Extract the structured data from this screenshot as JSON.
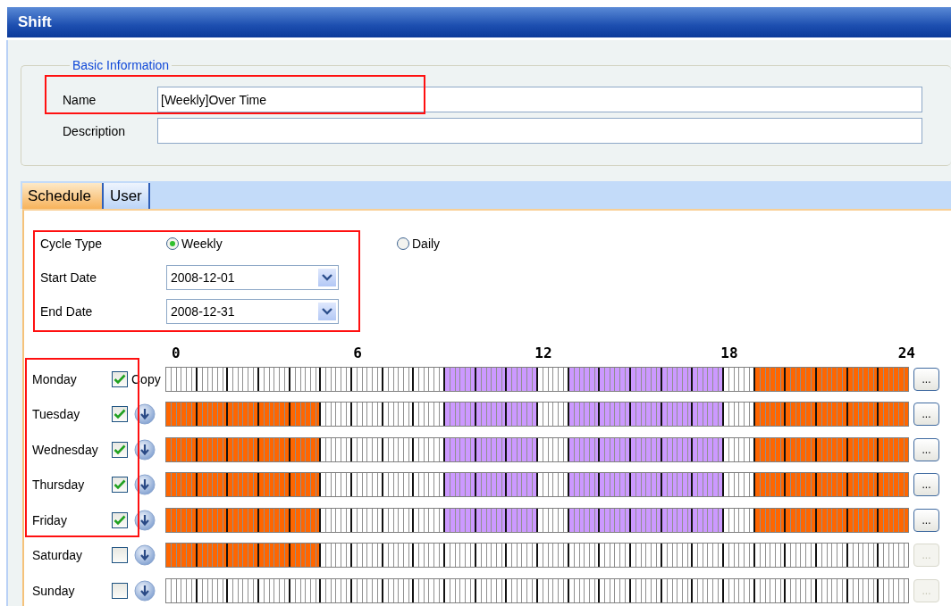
{
  "window": {
    "title": "Shift"
  },
  "basic_information": {
    "legend": "Basic Information",
    "name": {
      "label": "Name",
      "value": "[Weekly]Over Time"
    },
    "description": {
      "label": "Description"
    }
  },
  "tabs": [
    {
      "label": "Schedule",
      "selected": true
    },
    {
      "label": "User",
      "selected": false
    }
  ],
  "cycle_type": {
    "label": "Cycle Type",
    "options": [
      {
        "label": "Weekly",
        "selected": true
      },
      {
        "label": "Daily",
        "selected": false
      }
    ]
  },
  "start_date": {
    "label": "Start Date",
    "value": "2008-12-01"
  },
  "end_date": {
    "label": "End Date",
    "value": "2008-12-31"
  },
  "hour_labels": [
    "0",
    "6",
    "12",
    "18",
    "24"
  ],
  "days": [
    {
      "name": "Monday",
      "checked": true,
      "action": {
        "kind": "copy",
        "label": "Copy"
      },
      "button": "...",
      "button_disabled": false,
      "hours": [
        {
          "color": "#ffffff"
        },
        {
          "color": "#ffffff"
        },
        {
          "color": "#ffffff"
        },
        {
          "color": "#ffffff"
        },
        {
          "color": "#ffffff"
        },
        {
          "color": "#ffffff"
        },
        {
          "color": "#ffffff"
        },
        {
          "color": "#ffffff"
        },
        {
          "color": "#ffffff"
        },
        {
          "color": "#cc99ff"
        },
        {
          "color": "#cc99ff"
        },
        {
          "color": "#cc99ff"
        },
        {
          "color": "#ffffff"
        },
        {
          "color": "#cc99ff"
        },
        {
          "color": "#cc99ff"
        },
        {
          "color": "#cc99ff"
        },
        {
          "color": "#cc99ff"
        },
        {
          "color": "#cc99ff"
        },
        {
          "color": "#ffffff"
        },
        {
          "color": "#ff6600"
        },
        {
          "color": "#ff6600"
        },
        {
          "color": "#ff6600"
        },
        {
          "color": "#ff6600"
        },
        {
          "color": "#ff6600"
        }
      ]
    },
    {
      "name": "Tuesday",
      "checked": true,
      "action": {
        "kind": "arrow"
      },
      "button": "...",
      "button_disabled": false,
      "hours": [
        {
          "color": "#ff6600"
        },
        {
          "color": "#ff6600"
        },
        {
          "color": "#ff6600"
        },
        {
          "color": "#ff6600"
        },
        {
          "color": "#ff6600"
        },
        {
          "color": "#ffffff"
        },
        {
          "color": "#ffffff"
        },
        {
          "color": "#ffffff"
        },
        {
          "color": "#ffffff"
        },
        {
          "color": "#cc99ff"
        },
        {
          "color": "#cc99ff"
        },
        {
          "color": "#cc99ff"
        },
        {
          "color": "#ffffff"
        },
        {
          "color": "#cc99ff"
        },
        {
          "color": "#cc99ff"
        },
        {
          "color": "#cc99ff"
        },
        {
          "color": "#cc99ff"
        },
        {
          "color": "#cc99ff"
        },
        {
          "color": "#ffffff"
        },
        {
          "color": "#ff6600"
        },
        {
          "color": "#ff6600"
        },
        {
          "color": "#ff6600"
        },
        {
          "color": "#ff6600"
        },
        {
          "color": "#ff6600"
        }
      ]
    },
    {
      "name": "Wednesday",
      "checked": true,
      "action": {
        "kind": "arrow"
      },
      "button": "...",
      "button_disabled": false,
      "hours": [
        {
          "color": "#ff6600"
        },
        {
          "color": "#ff6600"
        },
        {
          "color": "#ff6600"
        },
        {
          "color": "#ff6600"
        },
        {
          "color": "#ff6600"
        },
        {
          "color": "#ffffff"
        },
        {
          "color": "#ffffff"
        },
        {
          "color": "#ffffff"
        },
        {
          "color": "#ffffff"
        },
        {
          "color": "#cc99ff"
        },
        {
          "color": "#cc99ff"
        },
        {
          "color": "#cc99ff"
        },
        {
          "color": "#ffffff"
        },
        {
          "color": "#cc99ff"
        },
        {
          "color": "#cc99ff"
        },
        {
          "color": "#cc99ff"
        },
        {
          "color": "#cc99ff"
        },
        {
          "color": "#cc99ff"
        },
        {
          "color": "#ffffff"
        },
        {
          "color": "#ff6600"
        },
        {
          "color": "#ff6600"
        },
        {
          "color": "#ff6600"
        },
        {
          "color": "#ff6600"
        },
        {
          "color": "#ff6600"
        }
      ]
    },
    {
      "name": "Thursday",
      "checked": true,
      "action": {
        "kind": "arrow"
      },
      "button": "...",
      "button_disabled": false,
      "hours": [
        {
          "color": "#ff6600"
        },
        {
          "color": "#ff6600"
        },
        {
          "color": "#ff6600"
        },
        {
          "color": "#ff6600"
        },
        {
          "color": "#ff6600"
        },
        {
          "color": "#ffffff"
        },
        {
          "color": "#ffffff"
        },
        {
          "color": "#ffffff"
        },
        {
          "color": "#ffffff"
        },
        {
          "color": "#cc99ff"
        },
        {
          "color": "#cc99ff"
        },
        {
          "color": "#cc99ff"
        },
        {
          "color": "#ffffff"
        },
        {
          "color": "#cc99ff"
        },
        {
          "color": "#cc99ff"
        },
        {
          "color": "#cc99ff"
        },
        {
          "color": "#cc99ff"
        },
        {
          "color": "#cc99ff"
        },
        {
          "color": "#ffffff"
        },
        {
          "color": "#ff6600"
        },
        {
          "color": "#ff6600"
        },
        {
          "color": "#ff6600"
        },
        {
          "color": "#ff6600"
        },
        {
          "color": "#ff6600"
        }
      ]
    },
    {
      "name": "Friday",
      "checked": true,
      "action": {
        "kind": "arrow"
      },
      "button": "...",
      "button_disabled": false,
      "hours": [
        {
          "color": "#ff6600"
        },
        {
          "color": "#ff6600"
        },
        {
          "color": "#ff6600"
        },
        {
          "color": "#ff6600"
        },
        {
          "color": "#ff6600"
        },
        {
          "color": "#ffffff"
        },
        {
          "color": "#ffffff"
        },
        {
          "color": "#ffffff"
        },
        {
          "color": "#ffffff"
        },
        {
          "color": "#cc99ff"
        },
        {
          "color": "#cc99ff"
        },
        {
          "color": "#cc99ff"
        },
        {
          "color": "#ffffff"
        },
        {
          "color": "#cc99ff"
        },
        {
          "color": "#cc99ff"
        },
        {
          "color": "#cc99ff"
        },
        {
          "color": "#cc99ff"
        },
        {
          "color": "#cc99ff"
        },
        {
          "color": "#ffffff"
        },
        {
          "color": "#ff6600"
        },
        {
          "color": "#ff6600"
        },
        {
          "color": "#ff6600"
        },
        {
          "color": "#ff6600"
        },
        {
          "color": "#ff6600"
        }
      ]
    },
    {
      "name": "Saturday",
      "checked": false,
      "action": {
        "kind": "arrow"
      },
      "button": "...",
      "button_disabled": true,
      "hours": [
        {
          "color": "#ff6600"
        },
        {
          "color": "#ff6600"
        },
        {
          "color": "#ff6600"
        },
        {
          "color": "#ff6600"
        },
        {
          "color": "#ff6600"
        },
        {
          "color": "#ffffff"
        },
        {
          "color": "#ffffff"
        },
        {
          "color": "#ffffff"
        },
        {
          "color": "#ffffff"
        },
        {
          "color": "#ffffff"
        },
        {
          "color": "#ffffff"
        },
        {
          "color": "#ffffff"
        },
        {
          "color": "#ffffff"
        },
        {
          "color": "#ffffff"
        },
        {
          "color": "#ffffff"
        },
        {
          "color": "#ffffff"
        },
        {
          "color": "#ffffff"
        },
        {
          "color": "#ffffff"
        },
        {
          "color": "#ffffff"
        },
        {
          "color": "#ffffff"
        },
        {
          "color": "#ffffff"
        },
        {
          "color": "#ffffff"
        },
        {
          "color": "#ffffff"
        },
        {
          "color": "#ffffff"
        }
      ]
    },
    {
      "name": "Sunday",
      "checked": false,
      "action": {
        "kind": "arrow"
      },
      "button": "...",
      "button_disabled": true,
      "hours": [
        {
          "color": "#ffffff"
        },
        {
          "color": "#ffffff"
        },
        {
          "color": "#ffffff"
        },
        {
          "color": "#ffffff"
        },
        {
          "color": "#ffffff"
        },
        {
          "color": "#ffffff"
        },
        {
          "color": "#ffffff"
        },
        {
          "color": "#ffffff"
        },
        {
          "color": "#ffffff"
        },
        {
          "color": "#ffffff"
        },
        {
          "color": "#ffffff"
        },
        {
          "color": "#ffffff"
        },
        {
          "color": "#ffffff"
        },
        {
          "color": "#ffffff"
        },
        {
          "color": "#ffffff"
        },
        {
          "color": "#ffffff"
        },
        {
          "color": "#ffffff"
        },
        {
          "color": "#ffffff"
        },
        {
          "color": "#ffffff"
        },
        {
          "color": "#ffffff"
        },
        {
          "color": "#ffffff"
        },
        {
          "color": "#ffffff"
        },
        {
          "color": "#ffffff"
        },
        {
          "color": "#ffffff"
        }
      ]
    }
  ]
}
